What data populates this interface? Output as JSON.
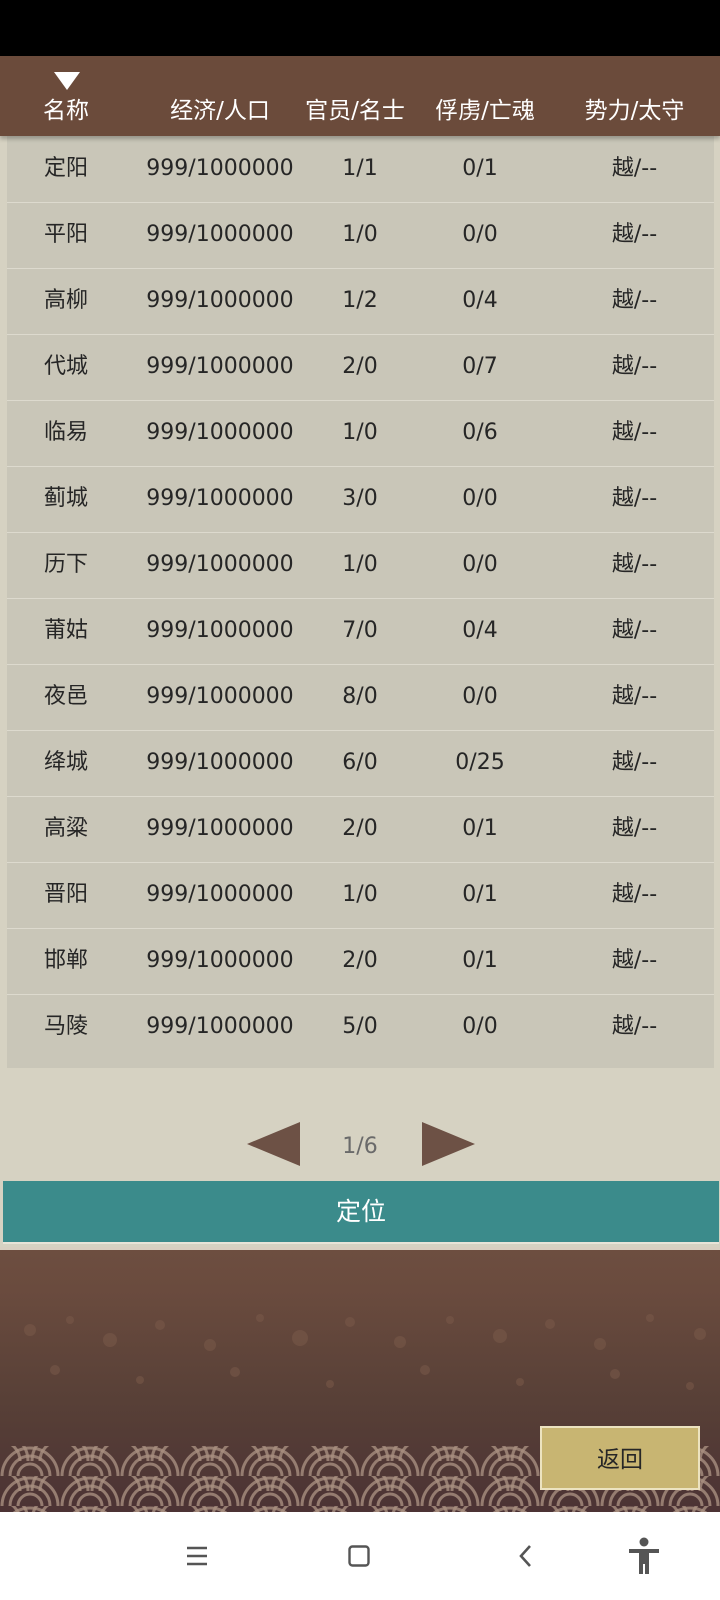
{
  "header": {
    "columns": [
      "名称",
      "经济/人口",
      "官员/名士",
      "俘虏/亡魂",
      "势力/太守"
    ]
  },
  "rows": [
    {
      "name": "定阳",
      "econ_pop": "999/1000000",
      "officials": "1/1",
      "captives": "0/1",
      "faction": "越/--"
    },
    {
      "name": "平阳",
      "econ_pop": "999/1000000",
      "officials": "1/0",
      "captives": "0/0",
      "faction": "越/--"
    },
    {
      "name": "高柳",
      "econ_pop": "999/1000000",
      "officials": "1/2",
      "captives": "0/4",
      "faction": "越/--"
    },
    {
      "name": "代城",
      "econ_pop": "999/1000000",
      "officials": "2/0",
      "captives": "0/7",
      "faction": "越/--"
    },
    {
      "name": "临易",
      "econ_pop": "999/1000000",
      "officials": "1/0",
      "captives": "0/6",
      "faction": "越/--"
    },
    {
      "name": "蓟城",
      "econ_pop": "999/1000000",
      "officials": "3/0",
      "captives": "0/0",
      "faction": "越/--"
    },
    {
      "name": "历下",
      "econ_pop": "999/1000000",
      "officials": "1/0",
      "captives": "0/0",
      "faction": "越/--"
    },
    {
      "name": "莆姑",
      "econ_pop": "999/1000000",
      "officials": "7/0",
      "captives": "0/4",
      "faction": "越/--"
    },
    {
      "name": "夜邑",
      "econ_pop": "999/1000000",
      "officials": "8/0",
      "captives": "0/0",
      "faction": "越/--"
    },
    {
      "name": "绛城",
      "econ_pop": "999/1000000",
      "officials": "6/0",
      "captives": "0/25",
      "faction": "越/--"
    },
    {
      "name": "高粱",
      "econ_pop": "999/1000000",
      "officials": "2/0",
      "captives": "0/1",
      "faction": "越/--"
    },
    {
      "name": "晋阳",
      "econ_pop": "999/1000000",
      "officials": "1/0",
      "captives": "0/1",
      "faction": "越/--"
    },
    {
      "name": "邯郸",
      "econ_pop": "999/1000000",
      "officials": "2/0",
      "captives": "0/1",
      "faction": "越/--"
    },
    {
      "name": "马陵",
      "econ_pop": "999/1000000",
      "officials": "5/0",
      "captives": "0/0",
      "faction": "越/--"
    }
  ],
  "pager": {
    "text": "1/6"
  },
  "actions": {
    "locate_label": "定位",
    "return_label": "返回"
  },
  "icons": {
    "sort": "triangle-down-icon",
    "prev": "triangle-left-icon",
    "next": "triangle-right-icon",
    "nav": [
      "menu-icon",
      "home-square-icon",
      "back-chevron-icon",
      "accessibility-icon"
    ]
  },
  "colors": {
    "header_bg": "#6b4b3b",
    "table_bg": "#c9c6b8",
    "page_bg": "#d6d2c2",
    "locate_button": "#3b8b8b",
    "return_button": "#c8b572",
    "pager_arrow": "#6d5145"
  }
}
